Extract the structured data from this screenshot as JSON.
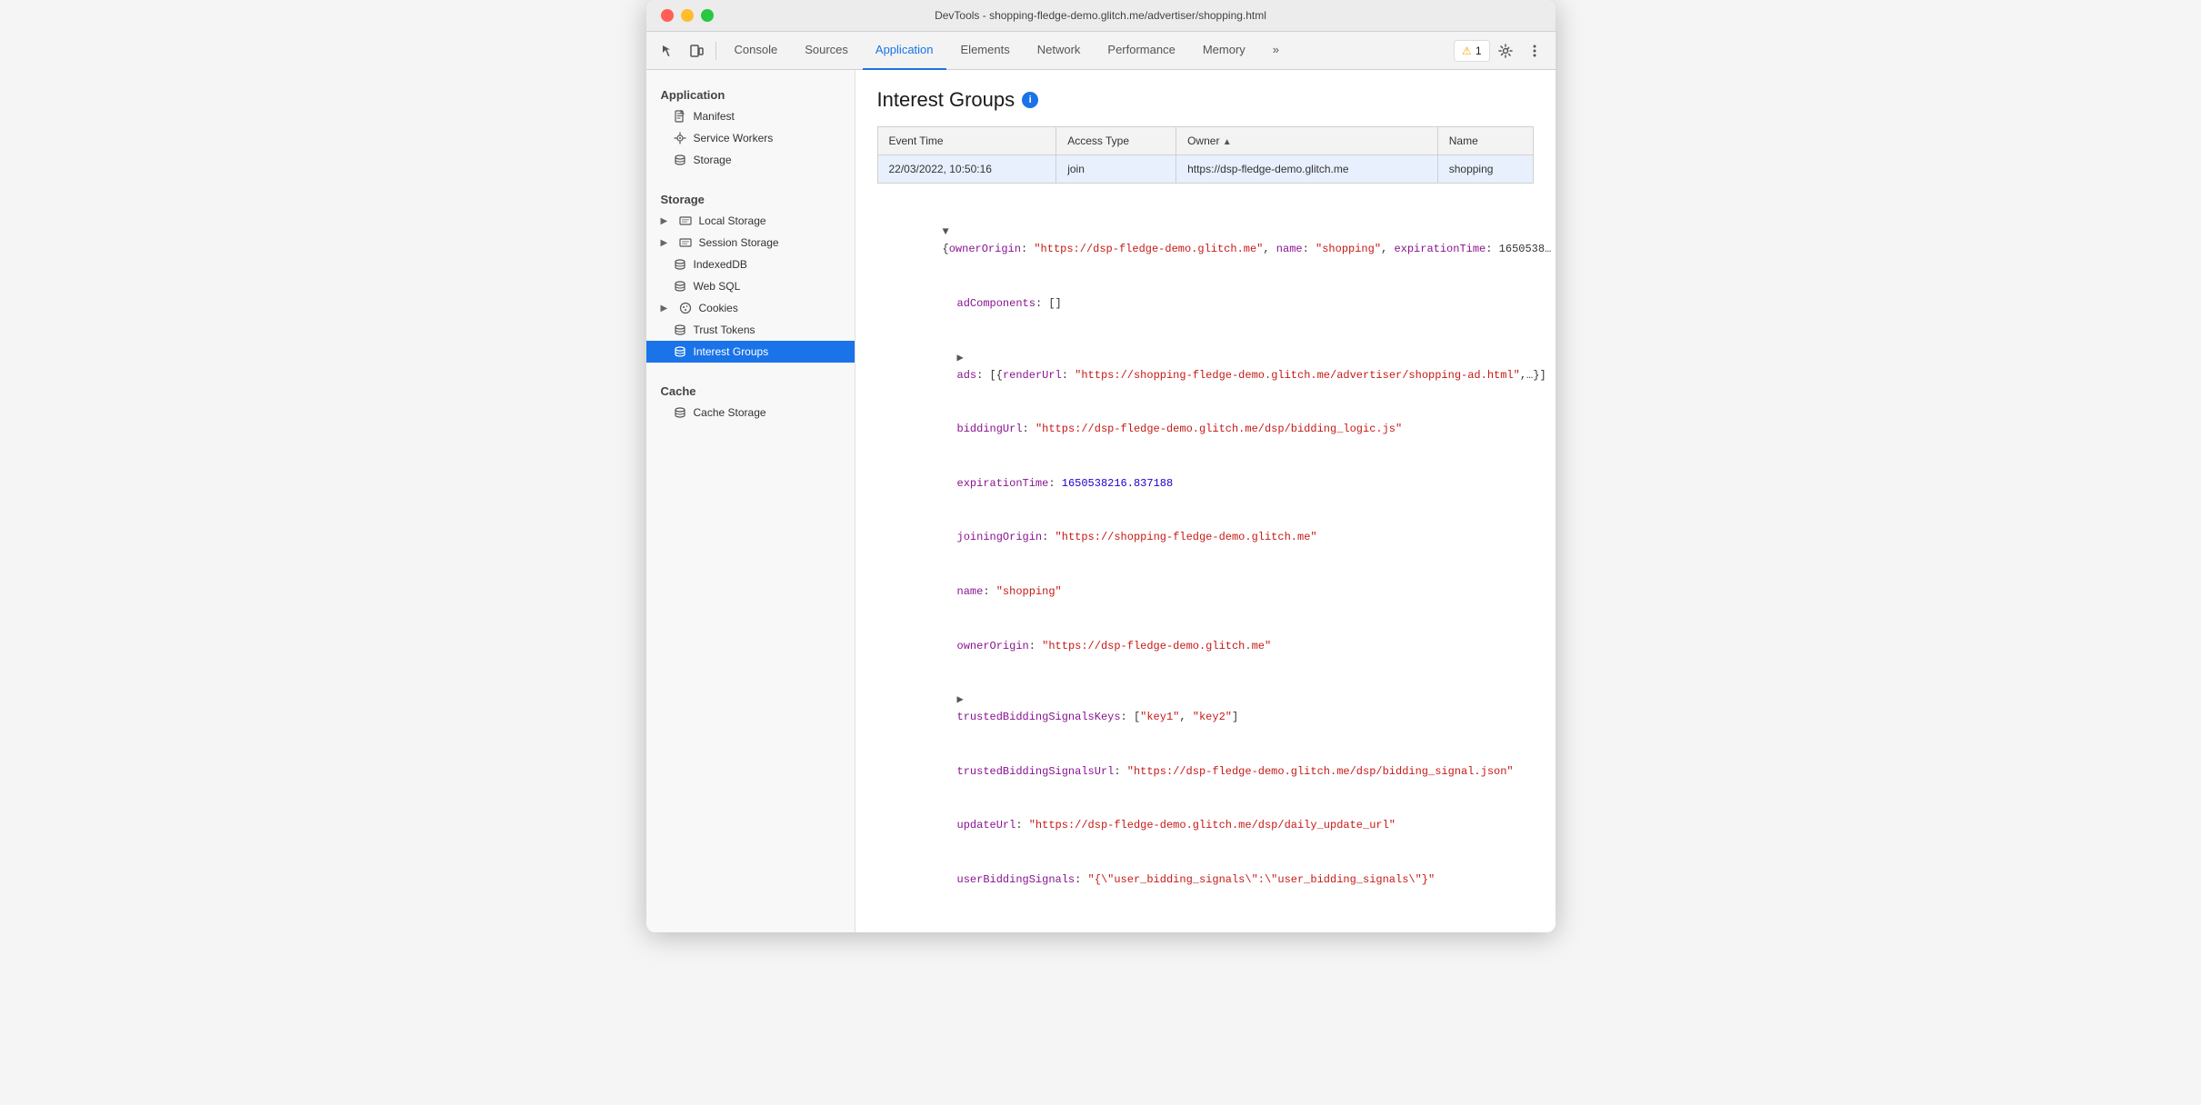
{
  "window": {
    "title": "DevTools - shopping-fledge-demo.glitch.me/advertiser/shopping.html"
  },
  "toolbar": {
    "tabs": [
      {
        "id": "console",
        "label": "Console",
        "active": false
      },
      {
        "id": "sources",
        "label": "Sources",
        "active": false
      },
      {
        "id": "application",
        "label": "Application",
        "active": true
      },
      {
        "id": "elements",
        "label": "Elements",
        "active": false
      },
      {
        "id": "network",
        "label": "Network",
        "active": false
      },
      {
        "id": "performance",
        "label": "Performance",
        "active": false
      },
      {
        "id": "memory",
        "label": "Memory",
        "active": false
      }
    ],
    "more_label": "»",
    "warning_count": "1",
    "warning_icon": "⚠"
  },
  "sidebar": {
    "section_application": "Application",
    "section_storage": "Storage",
    "section_cache": "Cache",
    "items_application": [
      {
        "id": "manifest",
        "label": "Manifest",
        "icon": "📄"
      },
      {
        "id": "service-workers",
        "label": "Service Workers",
        "icon": "⚙"
      },
      {
        "id": "storage",
        "label": "Storage",
        "icon": "🗄"
      }
    ],
    "items_storage": [
      {
        "id": "local-storage",
        "label": "Local Storage",
        "icon": "▦",
        "expandable": true
      },
      {
        "id": "session-storage",
        "label": "Session Storage",
        "icon": "▦",
        "expandable": true
      },
      {
        "id": "indexeddb",
        "label": "IndexedDB",
        "icon": "🗄"
      },
      {
        "id": "websql",
        "label": "Web SQL",
        "icon": "🗄"
      },
      {
        "id": "cookies",
        "label": "Cookies",
        "icon": "🍪",
        "expandable": true
      },
      {
        "id": "trust-tokens",
        "label": "Trust Tokens",
        "icon": "🗄"
      },
      {
        "id": "interest-groups",
        "label": "Interest Groups",
        "icon": "🗄",
        "active": true
      }
    ],
    "items_cache": [
      {
        "id": "cache-storage",
        "label": "Cache Storage",
        "icon": "🗄"
      }
    ]
  },
  "content": {
    "title": "Interest Groups",
    "table": {
      "columns": [
        {
          "id": "event-time",
          "label": "Event Time"
        },
        {
          "id": "access-type",
          "label": "Access Type"
        },
        {
          "id": "owner",
          "label": "Owner",
          "sorted": true,
          "sort_dir": "asc"
        },
        {
          "id": "name",
          "label": "Name"
        }
      ],
      "rows": [
        {
          "event_time": "22/03/2022, 10:50:16",
          "access_type": "join",
          "owner": "https://dsp-fledge-demo.glitch.me",
          "name": "shopping",
          "selected": true
        }
      ]
    },
    "json": {
      "root_key": "ownerOrigin",
      "root_preview": "{ownerOrigin: \"https://dsp-fledge-demo.glitch.me\", name: \"shopping\", expirationTime: 1650538...",
      "lines": [
        {
          "indent": 0,
          "type": "root-open",
          "text": "▼ {ownerOrigin: \"https://dsp-fledge-demo.glitch.me\", name: \"shopping\", expirationTime: 1650538..."
        },
        {
          "indent": 1,
          "type": "key-value",
          "key": "adComponents",
          "value": "[]",
          "value_type": "bracket"
        },
        {
          "indent": 1,
          "type": "key-expand",
          "key": "ads",
          "value": "[{renderUrl: \"https://shopping-fledge-demo.glitch.me/advertiser/shopping-ad.html\",…}]",
          "expanded": false
        },
        {
          "indent": 1,
          "type": "key-string",
          "key": "biddingUrl",
          "value": "\"https://dsp-fledge-demo.glitch.me/dsp/bidding_logic.js\""
        },
        {
          "indent": 1,
          "type": "key-number",
          "key": "expirationTime",
          "value": "1650538216.837188"
        },
        {
          "indent": 1,
          "type": "key-string",
          "key": "joiningOrigin",
          "value": "\"https://shopping-fledge-demo.glitch.me\""
        },
        {
          "indent": 1,
          "type": "key-string",
          "key": "name",
          "value": "\"shopping\""
        },
        {
          "indent": 1,
          "type": "key-string",
          "key": "ownerOrigin",
          "value": "\"https://dsp-fledge-demo.glitch.me\""
        },
        {
          "indent": 1,
          "type": "key-expand",
          "key": "trustedBiddingSignalsKeys",
          "value": "[\"key1\", \"key2\"]",
          "expanded": false
        },
        {
          "indent": 1,
          "type": "key-string",
          "key": "trustedBiddingSignalsUrl",
          "value": "\"https://dsp-fledge-demo.glitch.me/dsp/bidding_signal.json\""
        },
        {
          "indent": 1,
          "type": "key-string",
          "key": "updateUrl",
          "value": "\"https://dsp-fledge-demo.glitch.me/dsp/daily_update_url\""
        },
        {
          "indent": 1,
          "type": "key-string",
          "key": "userBiddingSignals",
          "value": "\"{\\\"user_bidding_signals\\\":\\\"user_bidding_signals\\\"}\""
        }
      ]
    }
  }
}
